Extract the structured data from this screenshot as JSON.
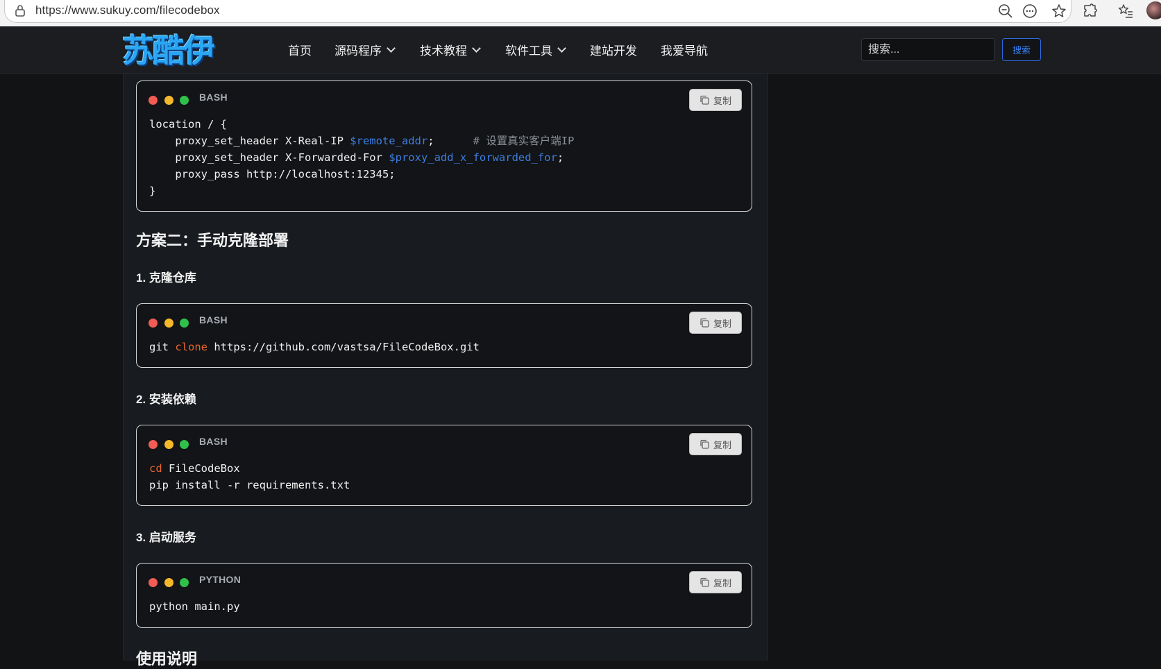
{
  "browser": {
    "url": "https://www.sukuy.com/filecodebox",
    "icons": [
      "lock-icon",
      "zoom-out-icon",
      "more-icon",
      "favorite-star-icon",
      "extensions-icon",
      "favorites-list-icon",
      "profile-avatar"
    ]
  },
  "header": {
    "logo_text": "苏酷伊",
    "nav": [
      {
        "label": "首页",
        "dropdown": false
      },
      {
        "label": "源码程序",
        "dropdown": true
      },
      {
        "label": "技术教程",
        "dropdown": true
      },
      {
        "label": "软件工具",
        "dropdown": true
      },
      {
        "label": "建站开发",
        "dropdown": false
      },
      {
        "label": "我爱导航",
        "dropdown": false
      }
    ],
    "search_placeholder": "搜索...",
    "search_button": "搜索"
  },
  "copy_label": "复制",
  "blocks": {
    "nginx": {
      "lang": "BASH",
      "lines": {
        "l1": "location / {",
        "l2_a": "    proxy_set_header X-Real-IP ",
        "l2_var": "$remote_addr",
        "l2_b": ";      ",
        "l2_cmt": "# 设置真实客户端IP",
        "l3_a": "    proxy_set_header X-Forwarded-For ",
        "l3_var": "$proxy_add_x_forwarded_for",
        "l3_b": ";",
        "l4": "    proxy_pass http://localhost:12345;",
        "l5": "}"
      }
    },
    "clone": {
      "lang": "BASH",
      "cmd": "git ",
      "kw": "clone",
      "rest": " https://github.com/vastsa/FileCodeBox.git"
    },
    "deps": {
      "lang": "BASH",
      "kw": "cd",
      "rest": " FileCodeBox",
      "line2": "pip install -r requirements.txt"
    },
    "run": {
      "lang": "PYTHON",
      "line": "python main.py"
    }
  },
  "headings": {
    "plan2": "方案二：手动克隆部署",
    "step1": "1. 克隆仓库",
    "step2": "2. 安装依赖",
    "step3": "3. 启动服务",
    "usage": "使用说明"
  },
  "colors": {
    "page_bg": "#111315",
    "code_bg": "#121417",
    "variable": "#3d7de0",
    "keyword": "#e8652f",
    "comment": "#8a8f96",
    "search_button": "#3b82f6",
    "logo": "#2aa6f2"
  }
}
